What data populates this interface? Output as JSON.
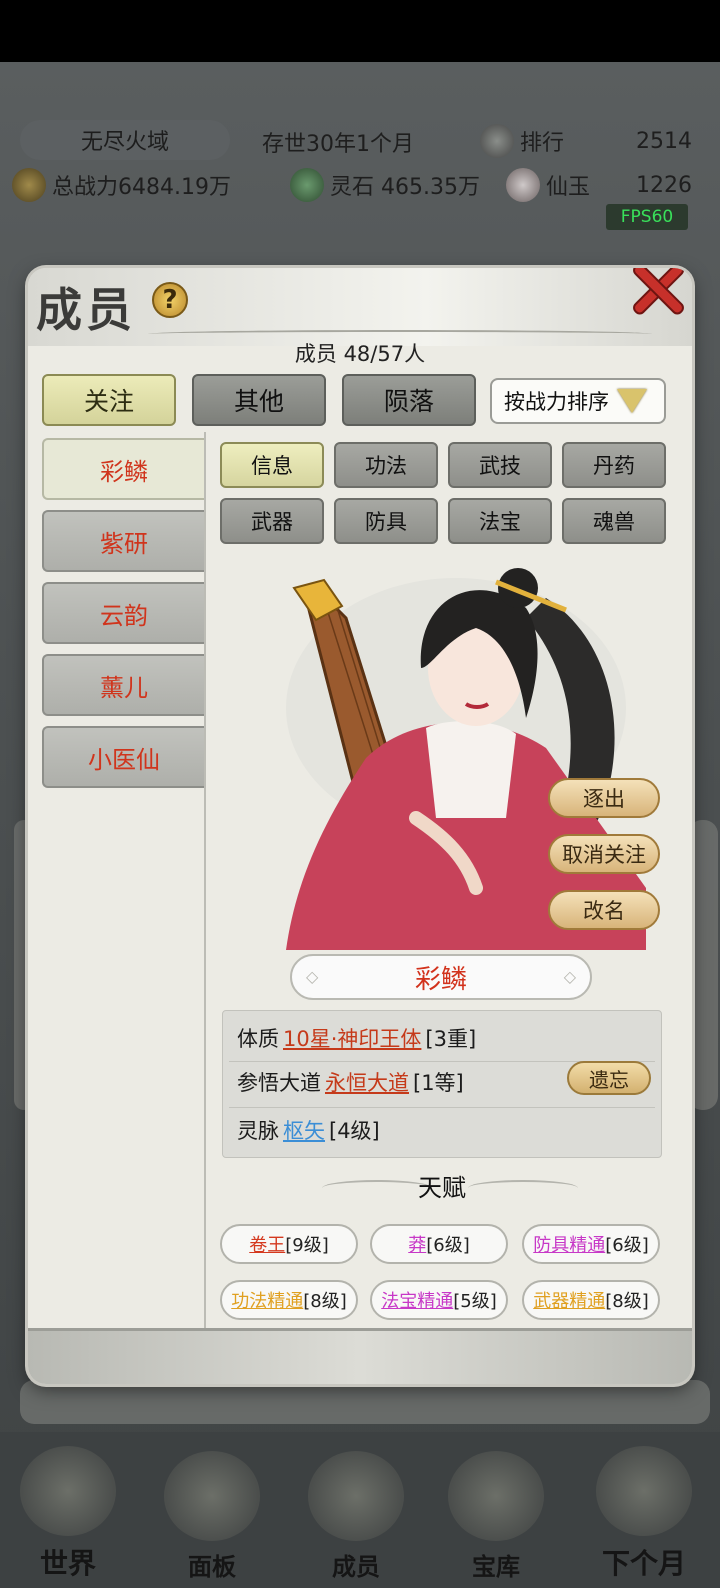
{
  "hud": {
    "region": "无尽火域",
    "age": "存世30年1个月",
    "rank_label": "排行",
    "rank_value": "2514",
    "power": "总战力6484.19万",
    "spirit_stone": "灵石 465.35万",
    "jade_label": "仙玉",
    "jade_value": "1226",
    "fps": "FPS60"
  },
  "dialog": {
    "title": "成员",
    "help": "?",
    "member_count": "成员  48/57人",
    "tabs": [
      "关注",
      "其他",
      "陨落"
    ],
    "active_tab": 0,
    "sort": "按战力排序",
    "members": [
      "彩鳞",
      "紫研",
      "云韵",
      "薰儿",
      "小医仙"
    ],
    "active_member": 0,
    "subtabs": [
      "信息",
      "功法",
      "武技",
      "丹药",
      "武器",
      "防具",
      "法宝",
      "魂兽"
    ],
    "active_subtab": 0,
    "actions": {
      "expel": "逐出",
      "unfollow": "取消关注",
      "rename": "改名"
    },
    "name": "彩鳞",
    "attrs": {
      "physique_label": "体质",
      "physique_value": "10星·神印王体",
      "physique_level": "[3重]",
      "dao_label": "参悟大道",
      "dao_value": "永恒大道",
      "dao_level": "[1等]",
      "forget": "遗忘",
      "vein_label": "灵脉",
      "vein_value": "枢矢",
      "vein_level": "[4级]"
    },
    "talent_title": "天赋",
    "talents": [
      {
        "name": "卷王",
        "level": "[9级]",
        "color": "#d4381e"
      },
      {
        "name": "莽",
        "level": "[6级]",
        "color": "#c738c7"
      },
      {
        "name": "防具精通",
        "level": "[6级]",
        "color": "#c738c7"
      },
      {
        "name": "功法精通",
        "level": "[8级]",
        "color": "#e0a020"
      },
      {
        "name": "法宝精通",
        "level": "[5级]",
        "color": "#c738c7"
      },
      {
        "name": "武器精通",
        "level": "[8级]",
        "color": "#e0a020"
      }
    ]
  },
  "nav": [
    "世界",
    "面板",
    "成员",
    "宝库",
    "下个月"
  ]
}
